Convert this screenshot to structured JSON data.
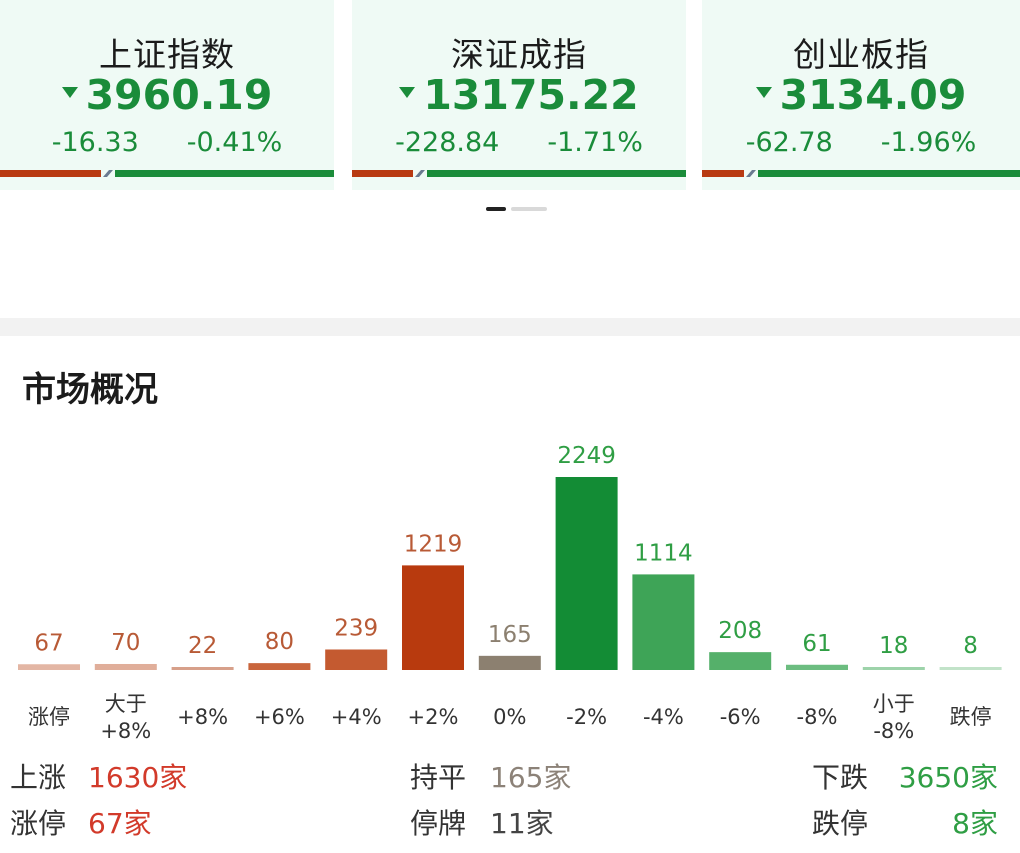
{
  "indices": [
    {
      "name": "上证指数",
      "value": "3960.19",
      "change": "-16.33",
      "pct": "-0.41%",
      "up_ratio": 0.32
    },
    {
      "name": "深证成指",
      "value": "13175.22",
      "change": "-228.84",
      "pct": "-1.71%",
      "up_ratio": 0.2
    },
    {
      "name": "创业板指",
      "value": "3134.09",
      "change": "-62.78",
      "pct": "-1.96%",
      "up_ratio": 0.15
    }
  ],
  "colors": {
    "up": "#b83a12",
    "down": "#1a8c3a",
    "flat": "#8c8070",
    "card_bg": "#effaf5"
  },
  "market": {
    "title": "市场概况",
    "summary": {
      "up_label": "上涨",
      "up_value": "1630家",
      "flat_label": "持平",
      "flat_value": "165家",
      "down_label": "下跌",
      "down_value": "3650家",
      "limit_up_label": "涨停",
      "limit_up_value": "67家",
      "halt_label": "停牌",
      "halt_value": "11家",
      "limit_down_label": "跌停",
      "limit_down_value": "8家"
    }
  },
  "chart_data": {
    "type": "bar",
    "categories": [
      "涨停",
      "大于\n+8%",
      "+8%",
      "+6%",
      "+4%",
      "+2%",
      "0%",
      "-2%",
      "-4%",
      "-6%",
      "-8%",
      "小于\n-8%",
      "跌停"
    ],
    "values": [
      67,
      70,
      22,
      80,
      239,
      1219,
      165,
      2249,
      1114,
      208,
      61,
      18,
      8
    ],
    "bar_colors": [
      "#e3b6a4",
      "#e0ae9a",
      "#d7a08a",
      "#c9653c",
      "#c45a30",
      "#b83a0e",
      "#8c8070",
      "#138c35",
      "#3ea457",
      "#55b06a",
      "#6cbd80",
      "#9dd3aa",
      "#c2e3c9"
    ],
    "label_colors": [
      "#b85a36",
      "#b85a36",
      "#b85a36",
      "#b85a36",
      "#b85a36",
      "#b85a36",
      "#8c8070",
      "#2f9e44",
      "#2f9e44",
      "#2f9e44",
      "#2f9e44",
      "#2f9e44",
      "#2f9e44"
    ],
    "title": "",
    "xlabel": "",
    "ylabel": "",
    "ylim": [
      0,
      2249
    ]
  }
}
